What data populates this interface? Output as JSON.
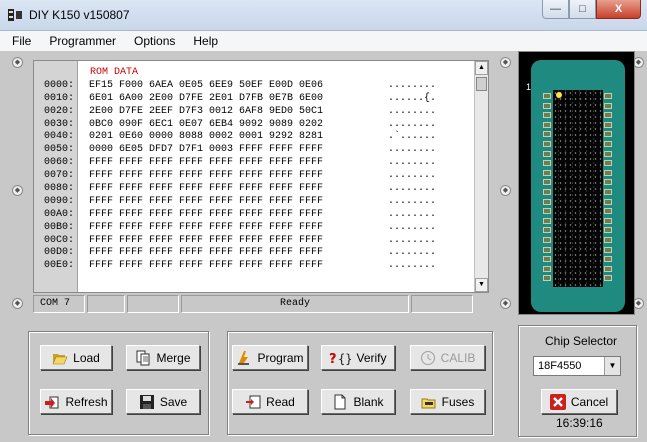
{
  "window": {
    "title": "DIY K150 v150807",
    "minimize": "—",
    "maximize": "□",
    "close": "X"
  },
  "menu": [
    "File",
    "Programmer",
    "Options",
    "Help"
  ],
  "hex": {
    "header": "ROM DATA",
    "rows": [
      {
        "addr": "0000:",
        "bytes": "EF15 F000 6AEA 0E05 6EE9 50EF E00D 0E06",
        "ascii": "........"
      },
      {
        "addr": "0010:",
        "bytes": "6E01 6A00 2E00 D7FE 2E01 D7FB 0E7B 6E00",
        "ascii": "......{."
      },
      {
        "addr": "0020:",
        "bytes": "2E00 D7FE 2EEF D7F3 0012 6AF8 9ED0 50C1",
        "ascii": "........"
      },
      {
        "addr": "0030:",
        "bytes": "0BC0 090F 6EC1 0E07 6EB4 9092 9089 0202",
        "ascii": "........"
      },
      {
        "addr": "0040:",
        "bytes": "0201 0E60 0000 8088 0002 0001 9292 8281",
        "ascii": ".`......"
      },
      {
        "addr": "0050:",
        "bytes": "0000 6E05 DFD7 D7F1 0003 FFFF FFFF FFFF",
        "ascii": "........"
      },
      {
        "addr": "0060:",
        "bytes": "FFFF FFFF FFFF FFFF FFFF FFFF FFFF FFFF",
        "ascii": "........"
      },
      {
        "addr": "0070:",
        "bytes": "FFFF FFFF FFFF FFFF FFFF FFFF FFFF FFFF",
        "ascii": "........"
      },
      {
        "addr": "0080:",
        "bytes": "FFFF FFFF FFFF FFFF FFFF FFFF FFFF FFFF",
        "ascii": "........"
      },
      {
        "addr": "0090:",
        "bytes": "FFFF FFFF FFFF FFFF FFFF FFFF FFFF FFFF",
        "ascii": "........"
      },
      {
        "addr": "00A0:",
        "bytes": "FFFF FFFF FFFF FFFF FFFF FFFF FFFF FFFF",
        "ascii": "........"
      },
      {
        "addr": "00B0:",
        "bytes": "FFFF FFFF FFFF FFFF FFFF FFFF FFFF FFFF",
        "ascii": "........"
      },
      {
        "addr": "00C0:",
        "bytes": "FFFF FFFF FFFF FFFF FFFF FFFF FFFF FFFF",
        "ascii": "........"
      },
      {
        "addr": "00D0:",
        "bytes": "FFFF FFFF FFFF FFFF FFFF FFFF FFFF FFFF",
        "ascii": "........"
      },
      {
        "addr": "00E0:",
        "bytes": "FFFF FFFF FFFF FFFF FFFF FFFF FFFF FFFF",
        "ascii": "........"
      }
    ]
  },
  "status": {
    "port": "COM 7",
    "message": "Ready"
  },
  "chip": {
    "pin_label": "1"
  },
  "buttons": {
    "load": "Load",
    "merge": "Merge",
    "refresh": "Refresh",
    "save": "Save",
    "program": "Program",
    "verify": "Verify",
    "calib": "CALIB",
    "read": "Read",
    "blank": "Blank",
    "fuses": "Fuses",
    "cancel": "Cancel"
  },
  "chip_selector": {
    "label": "Chip Selector",
    "value": "18F4550"
  },
  "clock": "16:39:16",
  "colors": {
    "pcb": "#1e8a80",
    "header_red": "#d00000"
  }
}
